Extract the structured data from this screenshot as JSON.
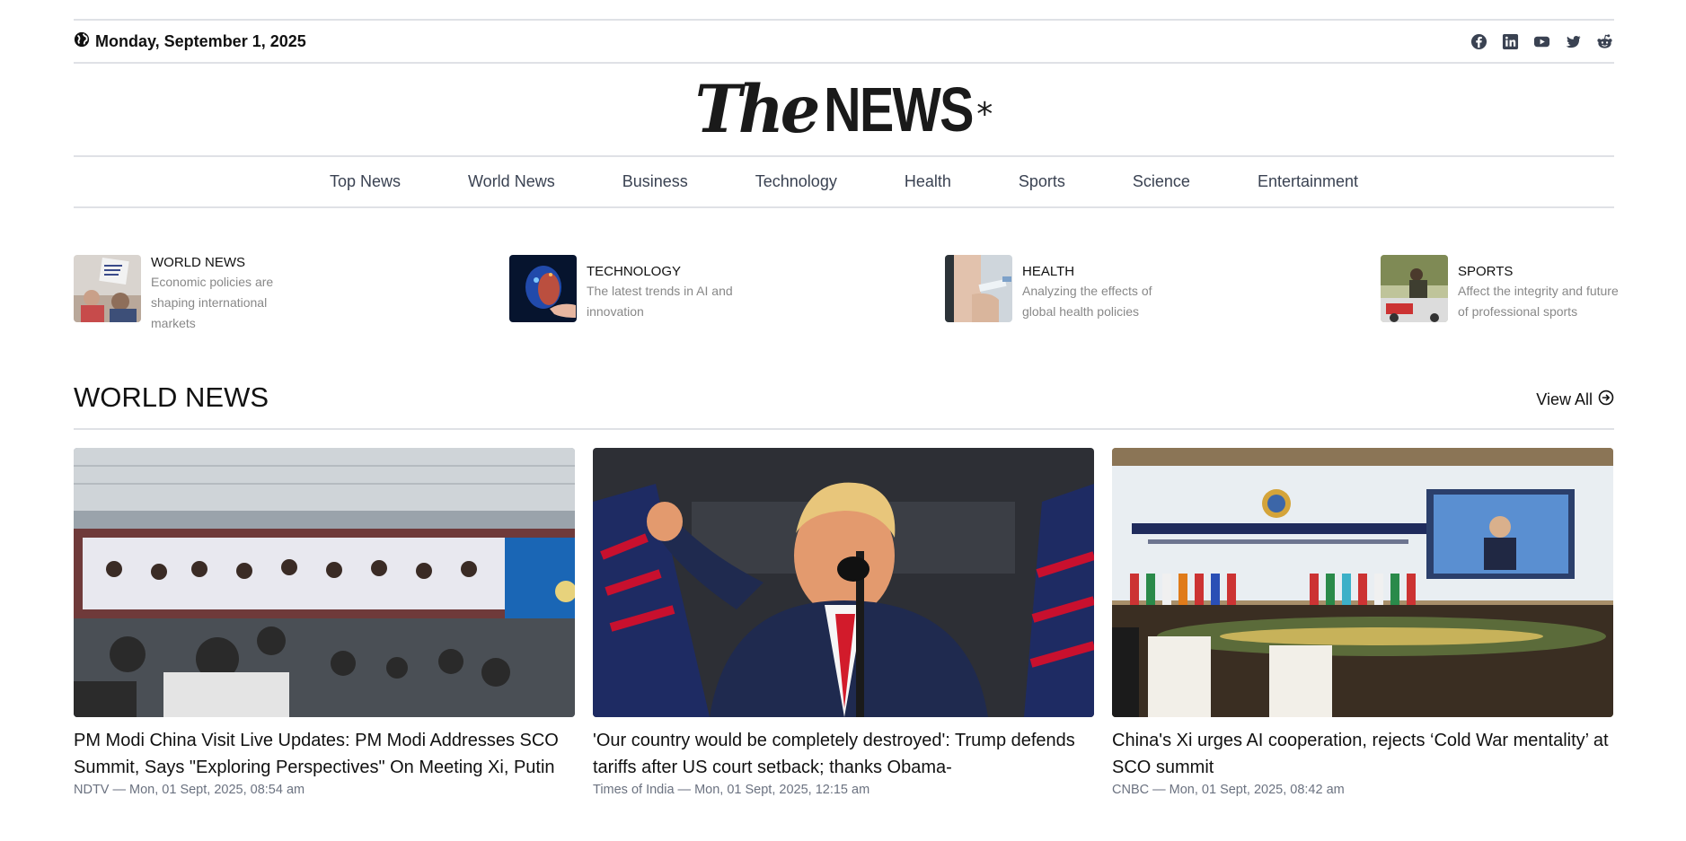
{
  "header": {
    "date": "Monday, September 1, 2025",
    "globe_icon": "globe-icon",
    "socials": [
      "facebook-icon",
      "linkedin-icon",
      "youtube-icon",
      "twitter-icon",
      "reddit-icon"
    ]
  },
  "logo": {
    "the": "The",
    "news": "NEWS",
    "asterisk": "*"
  },
  "nav": {
    "items": [
      "Top News",
      "World News",
      "Business",
      "Technology",
      "Health",
      "Sports",
      "Science",
      "Entertainment"
    ]
  },
  "featured": [
    {
      "category": "WORLD NEWS",
      "description": "Economic policies are shaping international markets"
    },
    {
      "category": "TECHNOLOGY",
      "description": "The latest trends in AI and innovation"
    },
    {
      "category": "HEALTH",
      "description": "Analyzing the effects of global health policies"
    },
    {
      "category": "SPORTS",
      "description": "Affect the integrity and future of professional sports"
    }
  ],
  "section": {
    "title": "WORLD NEWS",
    "view_all": "View All"
  },
  "articles": [
    {
      "title": "PM Modi China Visit Live Updates: PM Modi Addresses SCO Summit, Says \"Exploring Perspectives\" On Meeting Xi, Putin",
      "meta": "NDTV — Mon, 01 Sept, 2025, 08:54 am"
    },
    {
      "title": "'Our country would be completely destroyed': Trump defends tariffs after US court setback; thanks Obama-",
      "meta": "Times of India — Mon, 01 Sept, 2025, 12:15 am"
    },
    {
      "title": "China's Xi urges AI cooperation, rejects ‘Cold War mentality’ at SCO summit",
      "meta": "CNBC — Mon, 01 Sept, 2025, 08:42 am"
    }
  ],
  "colors": {
    "rule": "#dfe1e6",
    "nav_text": "#3a4252",
    "meta_text": "#6b7280"
  }
}
